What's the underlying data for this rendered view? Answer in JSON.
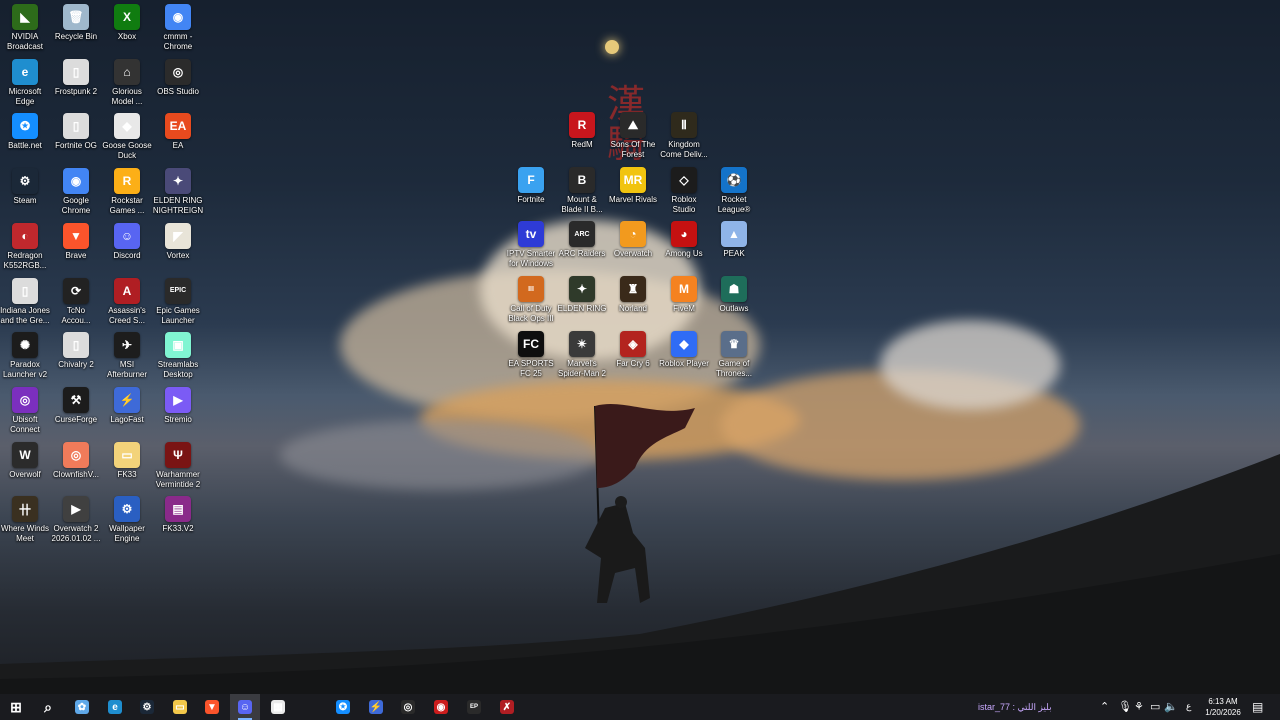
{
  "desktop": {
    "wallpaper_text": "漢\n騎\n\n",
    "icons": [
      {
        "label": "NVIDIA\nBroadcast",
        "icon": "nvidia-icon",
        "color": "#2d6b1a",
        "glyph": "◣"
      },
      {
        "label": "Recycle Bin",
        "icon": "recycle-bin-icon",
        "color": "#9fb8cc",
        "glyph": "🗑"
      },
      {
        "label": "Xbox",
        "icon": "xbox-icon",
        "color": "#107c10",
        "glyph": "X"
      },
      {
        "label": "cmmm -\nChrome",
        "icon": "chrome-icon",
        "color": "#4285f4",
        "glyph": "◉"
      },
      {
        "label": "Microsoft\nEdge",
        "icon": "edge-icon",
        "color": "#1f8ecf",
        "glyph": "e"
      },
      {
        "label": "Frostpunk 2",
        "icon": "file-icon",
        "color": "#dcdcdc",
        "glyph": "▯"
      },
      {
        "label": "Glorious\nModel ...",
        "icon": "mouse-icon",
        "color": "#333333",
        "glyph": "⌂"
      },
      {
        "label": "OBS Studio",
        "icon": "obs-icon",
        "color": "#2b2b2b",
        "glyph": "◎"
      },
      {
        "label": "Battle.net",
        "icon": "battlenet-icon",
        "color": "#148eff",
        "glyph": "✪"
      },
      {
        "label": "Fortnite OG",
        "icon": "file-icon",
        "color": "#dcdcdc",
        "glyph": "▯"
      },
      {
        "label": "Goose Goose\nDuck",
        "icon": "goose-icon",
        "color": "#e8e8e8",
        "glyph": "◆"
      },
      {
        "label": "EA",
        "icon": "ea-icon",
        "color": "#e84a1e",
        "glyph": "EA"
      },
      {
        "label": "Steam",
        "icon": "steam-icon",
        "color": "#1b2838",
        "glyph": "⚙"
      },
      {
        "label": "Google\nChrome",
        "icon": "chrome-icon",
        "color": "#4285f4",
        "glyph": "◉"
      },
      {
        "label": "Rockstar\nGames ...",
        "icon": "rockstar-icon",
        "color": "#fcaf17",
        "glyph": "R"
      },
      {
        "label": "ELDEN RING\nNIGHTREIGN",
        "icon": "elden-ring-icon",
        "color": "#4a4a78",
        "glyph": "✦"
      },
      {
        "label": "Redragon\nK552RGB...",
        "icon": "redragon-icon",
        "color": "#c0282d",
        "glyph": "◐"
      },
      {
        "label": "Brave",
        "icon": "brave-icon",
        "color": "#fb542b",
        "glyph": "▼"
      },
      {
        "label": "Discord",
        "icon": "discord-icon",
        "color": "#5865f2",
        "glyph": "☺"
      },
      {
        "label": "Vortex",
        "icon": "vortex-icon",
        "color": "#e8e4d8",
        "glyph": "◤"
      },
      {
        "label": "Indiana Jones\nand the Gre...",
        "icon": "file-icon",
        "color": "#dcdcdc",
        "glyph": "▯"
      },
      {
        "label": "TcNo\nAccou...",
        "icon": "tcno-icon",
        "color": "#222222",
        "glyph": "⟳"
      },
      {
        "label": "Assassin's\nCreed S...",
        "icon": "assassins-creed-icon",
        "color": "#b01e23",
        "glyph": "A"
      },
      {
        "label": "Epic Games\nLauncher",
        "icon": "epic-games-icon",
        "color": "#2a2a2a",
        "glyph": "EPIC"
      },
      {
        "label": "Paradox\nLauncher v2",
        "icon": "paradox-icon",
        "color": "#1c1c1c",
        "glyph": "✺"
      },
      {
        "label": "Chivalry 2",
        "icon": "file-icon",
        "color": "#dcdcdc",
        "glyph": "▯"
      },
      {
        "label": "MSI\nAfterburner",
        "icon": "msi-icon",
        "color": "#1d1d1d",
        "glyph": "✈"
      },
      {
        "label": "Streamlabs\nDesktop",
        "icon": "streamlabs-icon",
        "color": "#80f5d2",
        "glyph": "▣"
      },
      {
        "label": "Ubisoft\nConnect",
        "icon": "ubisoft-icon",
        "color": "#7b2fbe",
        "glyph": "◎"
      },
      {
        "label": "CurseForge",
        "icon": "curseforge-icon",
        "color": "#1c1c1c",
        "glyph": "⚒"
      },
      {
        "label": "LagoFast",
        "icon": "lagofast-icon",
        "color": "#3e6ad8",
        "glyph": "⚡"
      },
      {
        "label": "Stremio",
        "icon": "stremio-icon",
        "color": "#7b5bf5",
        "glyph": "▶"
      },
      {
        "label": "Overwolf",
        "icon": "overwolf-icon",
        "color": "#2b2b2b",
        "glyph": "W"
      },
      {
        "label": "ClownfishV...",
        "icon": "clownfish-icon",
        "color": "#f07b5a",
        "glyph": "◎"
      },
      {
        "label": "FK33",
        "icon": "folder-icon",
        "color": "#f3d37a",
        "glyph": "▭"
      },
      {
        "label": "Warhammer\nVermintide 2",
        "icon": "vermintide-icon",
        "color": "#7a1414",
        "glyph": "Ψ"
      },
      {
        "label": "Where Winds\nMeet",
        "icon": "where-winds-meet-icon",
        "color": "#3a3020",
        "glyph": "卄"
      },
      {
        "label": "Overwatch 2\n2026.01.02 ...",
        "icon": "video-icon",
        "color": "#404040",
        "glyph": "▶"
      },
      {
        "label": "Wallpaper\nEngine",
        "icon": "wallpaper-engine-icon",
        "color": "#2a5fc2",
        "glyph": "⚙"
      },
      {
        "label": "FK33.V2",
        "icon": "winrar-icon",
        "color": "#8a2a8a",
        "glyph": "▤"
      }
    ],
    "center_icons": [
      {
        "label": "RedM",
        "icon": "redm-icon",
        "color": "#c8161d",
        "glyph": "R"
      },
      {
        "label": "Sons Of The\nForest",
        "icon": "sons-forest-icon",
        "color": "#2a2a2a",
        "glyph": "⛰"
      },
      {
        "label": "Kingdom\nCome Deliv...",
        "icon": "kingdom-come-icon",
        "color": "#2f2a1c",
        "glyph": "Ⅱ"
      },
      {
        "label": "Fortnite",
        "icon": "fortnite-icon",
        "color": "#3aa2f0",
        "glyph": "F"
      },
      {
        "label": "Mount &\nBlade II B...",
        "icon": "bannerlord-icon",
        "color": "#2a2a2a",
        "glyph": "B"
      },
      {
        "label": "Marvel Rivals",
        "icon": "marvel-rivals-icon",
        "color": "#f1c40f",
        "glyph": "MR"
      },
      {
        "label": "Roblox\nStudio",
        "icon": "roblox-studio-icon",
        "color": "#1c1c1c",
        "glyph": "◇"
      },
      {
        "label": "Rocket\nLeague®",
        "icon": "rocket-league-icon",
        "color": "#1473c9",
        "glyph": "⚽"
      },
      {
        "label": "IPTV Smarter\nfor Windows",
        "icon": "iptv-icon",
        "color": "#2e3bd6",
        "glyph": "tv"
      },
      {
        "label": "ARC Raiders",
        "icon": "arc-raiders-icon",
        "color": "#2a2a2a",
        "glyph": "ARC"
      },
      {
        "label": "Overwatch",
        "icon": "overwatch-icon",
        "color": "#f29a1e",
        "glyph": "◔"
      },
      {
        "label": "Among Us",
        "icon": "among-us-icon",
        "color": "#c51111",
        "glyph": "◕"
      },
      {
        "label": "PEAK",
        "icon": "peak-icon",
        "color": "#8fb4e8",
        "glyph": "▲"
      },
      {
        "label": "Call of Duty\nBlack Ops III",
        "icon": "cod-icon",
        "color": "#d2691e",
        "glyph": "III"
      },
      {
        "label": "ELDEN RING",
        "icon": "elden-ring-icon",
        "color": "#2f3a2a",
        "glyph": "✦"
      },
      {
        "label": "Norland",
        "icon": "norland-icon",
        "color": "#3a2a1a",
        "glyph": "♜"
      },
      {
        "label": "FiveM",
        "icon": "fivem-icon",
        "color": "#f58220",
        "glyph": "M"
      },
      {
        "label": "Outlaws",
        "icon": "outlaws-icon",
        "color": "#1e6d5a",
        "glyph": "☗"
      },
      {
        "label": "EA SPORTS\nFC 25",
        "icon": "ea-fc-icon",
        "color": "#0e0e0e",
        "glyph": "FC"
      },
      {
        "label": "Marvel's\nSpider-Man 2",
        "icon": "spiderman-icon",
        "color": "#3a3a3a",
        "glyph": "✴"
      },
      {
        "label": "Far Cry 6",
        "icon": "far-cry-icon",
        "color": "#b3241f",
        "glyph": "◈"
      },
      {
        "label": "Roblox Player",
        "icon": "roblox-icon",
        "color": "#2f6cf5",
        "glyph": "◆"
      },
      {
        "label": "Game of\nThrones...",
        "icon": "got-icon",
        "color": "#5a6e8a",
        "glyph": "♛"
      }
    ]
  },
  "taskbar": {
    "apps": [
      {
        "name": "start",
        "icon": "windows-start-icon",
        "color": "#ffffff",
        "glyph": "⊞"
      },
      {
        "name": "search",
        "icon": "search-icon",
        "color": "#ffffff",
        "glyph": "⌕"
      },
      {
        "name": "copilot",
        "icon": "copilot-icon",
        "color": "#5fa8e8",
        "glyph": "✿"
      },
      {
        "name": "edge",
        "icon": "edge-icon",
        "color": "#1f8ecf",
        "glyph": "e"
      },
      {
        "name": "steam",
        "icon": "steam-icon",
        "color": "#1b2838",
        "glyph": "⚙"
      },
      {
        "name": "file-explorer",
        "icon": "folder-icon",
        "color": "#f3c84a",
        "glyph": "▭"
      },
      {
        "name": "brave",
        "icon": "brave-icon",
        "color": "#fb542b",
        "glyph": "▼"
      },
      {
        "name": "discord",
        "icon": "discord-icon",
        "color": "#5865f2",
        "glyph": "☺"
      },
      {
        "name": "calculator",
        "icon": "calculator-icon",
        "color": "#eaeaea",
        "glyph": "▦"
      },
      {
        "name": "battlenet",
        "icon": "battlenet-icon",
        "color": "#148eff",
        "glyph": "✪"
      },
      {
        "name": "lagofast",
        "icon": "lagofast-icon",
        "color": "#3e6ad8",
        "glyph": "⚡"
      },
      {
        "name": "steam-alt",
        "icon": "steam-icon",
        "color": "#2a2a2a",
        "glyph": "◎"
      },
      {
        "name": "media",
        "icon": "media-icon",
        "color": "#cc1d1d",
        "glyph": "◉"
      },
      {
        "name": "epic",
        "icon": "epic-games-icon",
        "color": "#2a2a2a",
        "glyph": "EP"
      },
      {
        "name": "tool",
        "icon": "tool-icon",
        "color": "#b01e23",
        "glyph": "✗"
      }
    ],
    "status_text": "istar_77 : بليز اللتي",
    "tray": {
      "time": "6:13 AM",
      "date": "1/20/2026",
      "lang": "ع"
    }
  }
}
